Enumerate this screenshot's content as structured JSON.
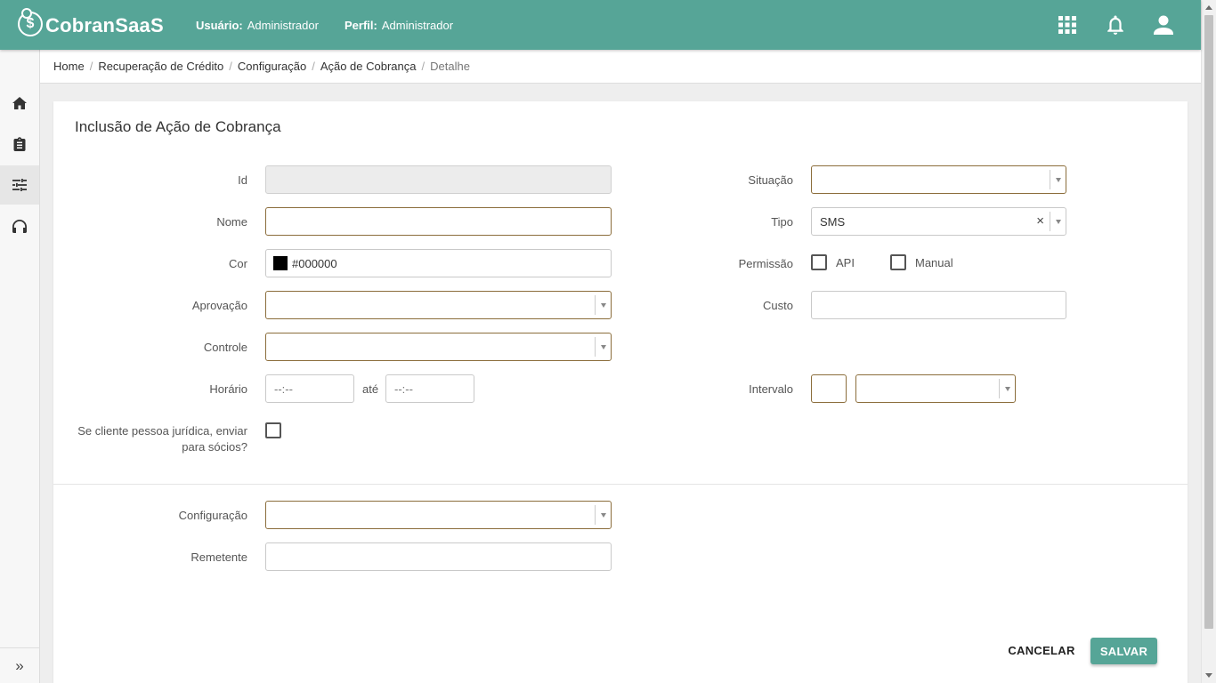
{
  "header": {
    "app_name": "CobranSaaS",
    "logo_symbol": "$",
    "user_label": "Usuário:",
    "user_value": "Administrador",
    "profile_label": "Perfil:",
    "profile_value": "Administrador",
    "icons": [
      "apps-grid-icon",
      "bell-icon",
      "user-icon"
    ],
    "color": "#56a597"
  },
  "sidebar": {
    "items": [
      "home-icon",
      "clipboard-icon",
      "sliders-icon",
      "headset-icon"
    ],
    "active_index": 2,
    "expand_label": "»"
  },
  "breadcrumb": {
    "items": [
      "Home",
      "Recuperação de Crédito",
      "Configuração",
      "Ação de Cobrança",
      "Detalhe"
    ],
    "separator": "/"
  },
  "form": {
    "title": "Inclusão de Ação de Cobrança",
    "left": {
      "id_label": "Id",
      "id_value": "",
      "nome_label": "Nome",
      "nome_value": "",
      "cor_label": "Cor",
      "cor_value": "#000000",
      "aprovacao_label": "Aprovação",
      "aprovacao_value": "",
      "controle_label": "Controle",
      "controle_value": "",
      "horario_label": "Horário",
      "horario_from_placeholder": "--:--",
      "horario_sep": "até",
      "horario_to_placeholder": "--:--",
      "socios_label_line1": "Se cliente pessoa jurídica, enviar",
      "socios_label_line2": "para sócios?",
      "socios_checked": false
    },
    "right": {
      "situacao_label": "Situação",
      "situacao_value": "",
      "tipo_label": "Tipo",
      "tipo_value": "SMS",
      "tipo_clear": "×",
      "permissao_label": "Permissão",
      "permissao_api_label": "API",
      "permissao_api_checked": false,
      "permissao_manual_label": "Manual",
      "permissao_manual_checked": false,
      "custo_label": "Custo",
      "custo_value": "",
      "intervalo_label": "Intervalo",
      "intervalo_value": "",
      "intervalo_unit": ""
    },
    "bottom": {
      "configuracao_label": "Configuração",
      "configuracao_value": "",
      "remetente_label": "Remetente",
      "remetente_value": ""
    },
    "actions": {
      "cancel_label": "CANCELAR",
      "save_label": "SALVAR"
    }
  }
}
